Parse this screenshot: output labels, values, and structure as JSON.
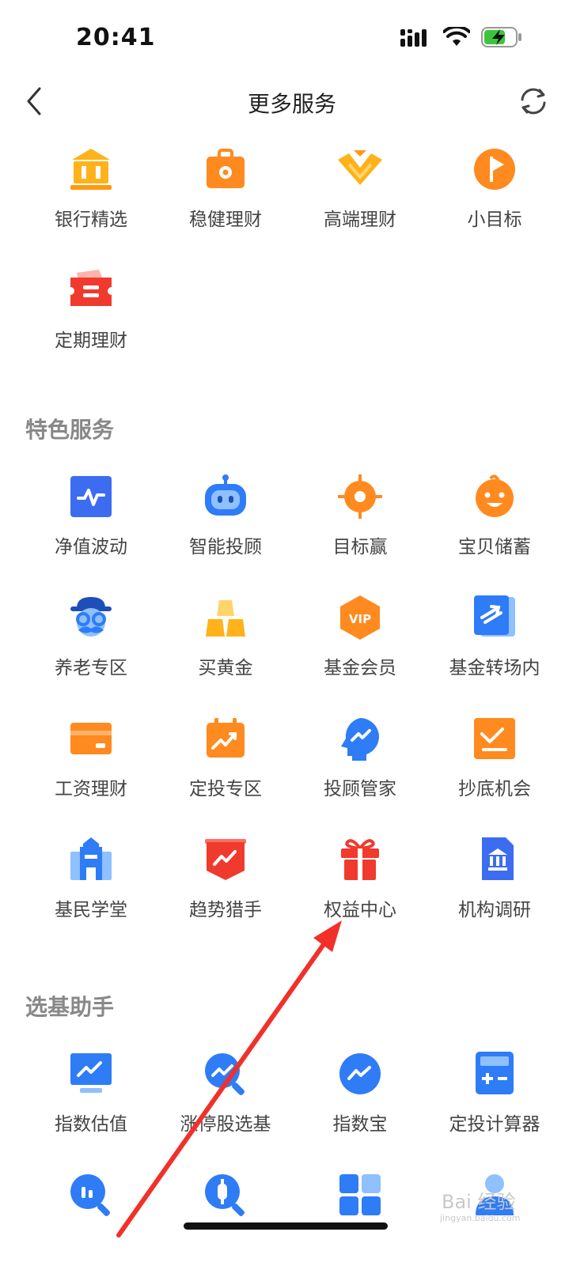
{
  "status_bar": {
    "time": "20:41"
  },
  "nav": {
    "title": "更多服务"
  },
  "top_items": [
    {
      "label": "银行精选",
      "icon": "bank-icon"
    },
    {
      "label": "稳健理财",
      "icon": "briefcase-icon"
    },
    {
      "label": "高端理财",
      "icon": "diamond-icon"
    },
    {
      "label": "小目标",
      "icon": "flag-circle-icon"
    },
    {
      "label": "定期理财",
      "icon": "ticket-icon"
    }
  ],
  "featured": {
    "title": "特色服务",
    "items": [
      {
        "label": "净值波动",
        "icon": "pulse-chart-icon"
      },
      {
        "label": "智能投顾",
        "icon": "robot-icon"
      },
      {
        "label": "目标赢",
        "icon": "target-icon"
      },
      {
        "label": "宝贝储蓄",
        "icon": "baby-face-icon"
      },
      {
        "label": "养老专区",
        "icon": "elder-face-icon"
      },
      {
        "label": "买黄金",
        "icon": "gold-bars-icon"
      },
      {
        "label": "基金会员",
        "icon": "vip-badge-icon",
        "badge": "VIP"
      },
      {
        "label": "基金转场内",
        "icon": "transfer-icon"
      },
      {
        "label": "工资理财",
        "icon": "card-icon"
      },
      {
        "label": "定投专区",
        "icon": "calendar-trend-icon"
      },
      {
        "label": "投顾管家",
        "icon": "head-trend-icon"
      },
      {
        "label": "抄底机会",
        "icon": "dip-chart-icon"
      },
      {
        "label": "基民学堂",
        "icon": "school-icon"
      },
      {
        "label": "趋势猎手",
        "icon": "trend-shield-icon"
      },
      {
        "label": "权益中心",
        "icon": "gift-icon"
      },
      {
        "label": "机构调研",
        "icon": "institution-icon"
      }
    ]
  },
  "fund_picker": {
    "title": "选基助手",
    "items": [
      {
        "label": "指数估值",
        "icon": "monitor-trend-icon"
      },
      {
        "label": "涨停股选基",
        "icon": "search-trend-icon"
      },
      {
        "label": "指数宝",
        "icon": "circle-trend-icon"
      },
      {
        "label": "定投计算器",
        "icon": "calculator-icon"
      },
      {
        "label": "",
        "icon": "search-bars-icon"
      },
      {
        "label": "",
        "icon": "search-coin-icon"
      },
      {
        "label": "",
        "icon": "grid-apps-icon"
      },
      {
        "label": "",
        "icon": "manager-icon"
      }
    ]
  },
  "watermark": {
    "text": "Bai 经验",
    "sub": "jingyan.baidu.com"
  },
  "colors": {
    "orange": "#FF8A1F",
    "yellow": "#FFB21A",
    "blue": "#2E7CF6",
    "red": "#F03A2E",
    "grey_title": "#888888"
  }
}
